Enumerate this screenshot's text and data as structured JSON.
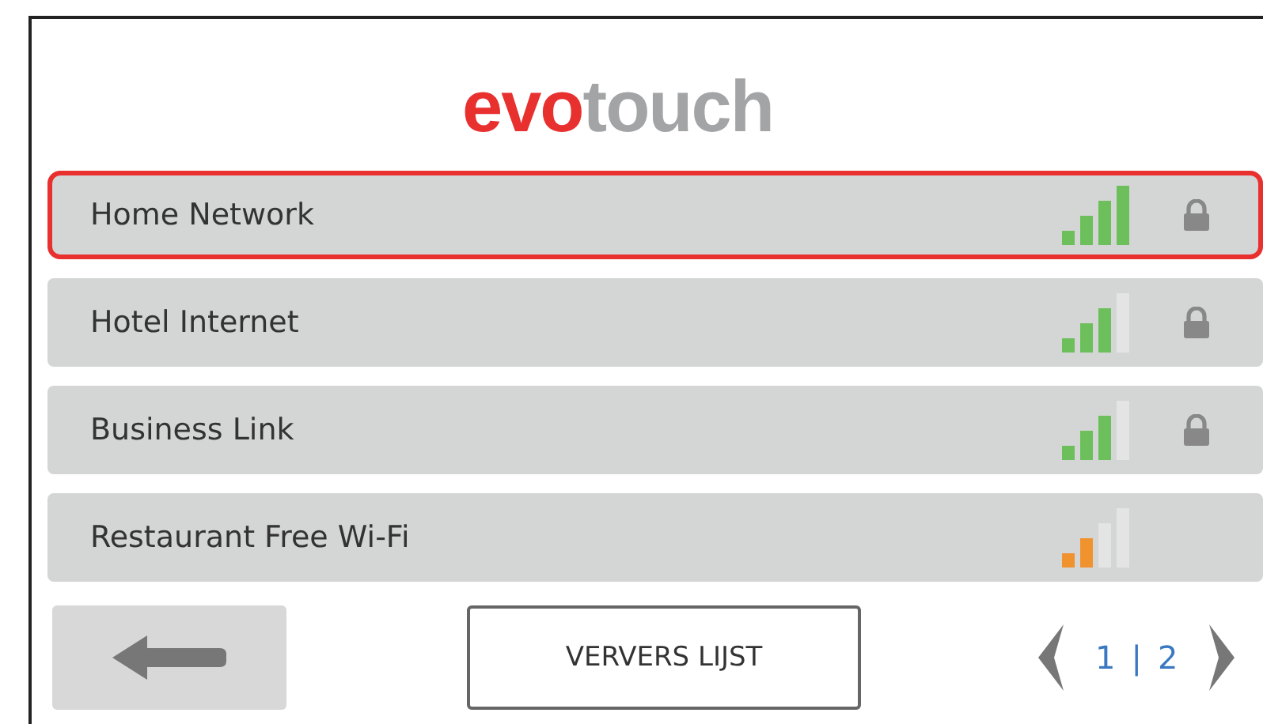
{
  "logo": {
    "accent": "evo",
    "rest": "touch"
  },
  "networks": [
    {
      "name": "Home Network",
      "full_signal": true,
      "weak_signal": false,
      "locked": true,
      "selected": true
    },
    {
      "name": "Hotel Internet",
      "full_signal": false,
      "weak_signal": false,
      "locked": true,
      "selected": false
    },
    {
      "name": "Business Link",
      "full_signal": false,
      "weak_signal": false,
      "locked": true,
      "selected": false
    },
    {
      "name": "Restaurant Free Wi-Fi",
      "full_signal": false,
      "weak_signal": true,
      "locked": false,
      "selected": false
    }
  ],
  "refresh_button": "VERVERS LIJST",
  "pager": {
    "current": "1",
    "separator": "|",
    "total": "2"
  }
}
